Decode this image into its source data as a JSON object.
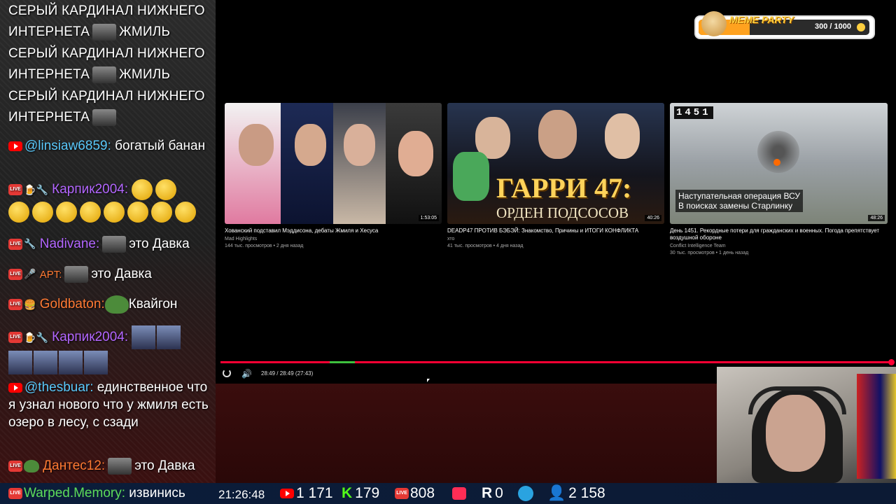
{
  "chat": {
    "spam_lines": [
      {
        "line1": "СЕРЫЙ КАРДИНАЛ НИЖНЕГО",
        "line2a": "ИНТЕРНЕТА",
        "line2b": "ЖМИЛЬ"
      },
      {
        "line1": "СЕРЫЙ КАРДИНАЛ НИЖНЕГО",
        "line2a": "ИНТЕРНЕТА",
        "line2b": "ЖМИЛЬ"
      },
      {
        "line1": "СЕРЫЙ КАРДИНАЛ НИЖНЕГО",
        "line2a": "ИНТЕРНЕТА",
        "line2b": ""
      }
    ],
    "messages": [
      {
        "user": "@linsiaw6859:",
        "text": "богатый банан"
      },
      {
        "user": "Карпик2004:",
        "text": ""
      },
      {
        "user": "Nadivane:",
        "text": "это Давка"
      },
      {
        "user": "APT:",
        "text": "это Давка"
      },
      {
        "user": "Goldbaton:",
        "text": "Квайгон"
      },
      {
        "user": "Карпик2004:",
        "text": ""
      },
      {
        "user": "@thesbuar:",
        "text": "единственное что я узнал нового что у жмиля есть озеро в лесу, с сзади"
      },
      {
        "user": "Дантес12:",
        "text": "это Давка"
      },
      {
        "user": "Warped.Memory:",
        "text": "извинись"
      }
    ],
    "live_badge": "LIVE"
  },
  "meme_party": {
    "label": "MEME PARTY",
    "progress_text": "300 / 1000",
    "progress_fraction": 0.3
  },
  "videos": [
    {
      "title": "Хованский подставил Мэддисона, дебаты Жмиля и Хесуса",
      "channel": "Mad Highlights",
      "meta": "144 тыс. просмотров • 2 дня назад",
      "duration": "1:53:05"
    },
    {
      "title": "DEADP47 ПРОТИВ БЭБЭЙ: Знакомство, Причины и ИТОГИ КОНФЛИКТА",
      "channel": "хто",
      "meta": "41 тыс. просмотров • 4 дня назад",
      "duration": "40:26",
      "thumb_title": "ГАРРИ 47:",
      "thumb_subtitle": "ОРДЕН ПОДСОСОВ"
    },
    {
      "title": "День 1451. Рекордные потери для гражданских и военных. Погода препятствует воздушной обороне",
      "channel": "Conflict Intelligence Team",
      "meta": "30 тыс. просмотров • 1 день назад",
      "duration": "48:26",
      "thumb_counter": "1451",
      "thumb_caption1": "Наступательная операция ВСУ",
      "thumb_caption2": "В поисках замены Старлинку"
    }
  ],
  "player": {
    "time": "28:49 / 28:49 (27:43)"
  },
  "bottom_bar": {
    "clock": "21:26:48",
    "youtube_viewers": "1 171",
    "kick_viewers": "179",
    "vk_viewers": "808",
    "rutube_viewers": "0",
    "total_viewers": "2 158",
    "kick_letter": "K",
    "rutube_letter": "R"
  },
  "colors": {
    "live_red": "#e53935",
    "youtube_red": "#ff0000",
    "progress_red": "#ff0033",
    "meme_orange": "#ffa21f"
  }
}
